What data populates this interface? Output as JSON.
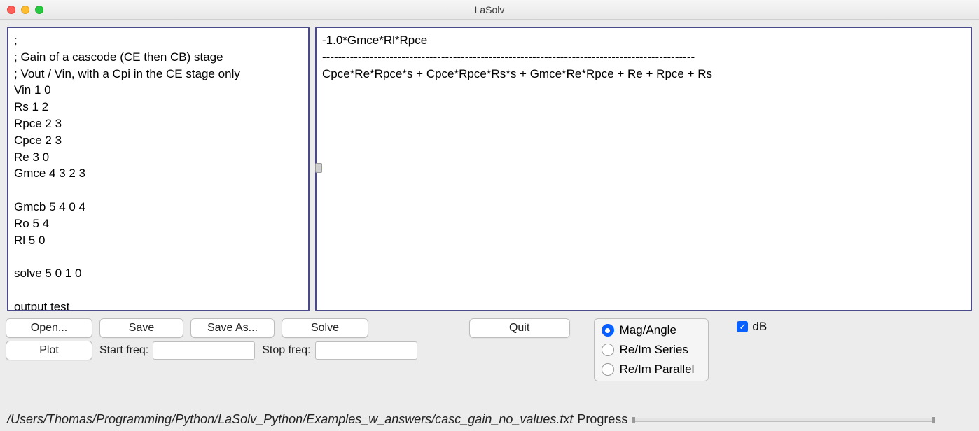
{
  "window": {
    "title": "LaSolv"
  },
  "editor": {
    "input_text": ";\n; Gain of a cascode (CE then CB) stage\n; Vout / Vin, with a Cpi in the CE stage only\nVin 1 0\nRs 1 2\nRpce 2 3\nCpce 2 3\nRe 3 0\nGmce 4 3 2 3\n\nGmcb 5 4 0 4\nRo 5 4\nRl 5 0\n\nsolve 5 0 1 0\n\noutput test",
    "output_text": "-1.0*Gmce*Rl*Rpce\n----------------------------------------------------------------------------------------------\nCpce*Re*Rpce*s + Cpce*Rpce*Rs*s + Gmce*Re*Rpce + Re + Rpce + Rs"
  },
  "buttons": {
    "open": "Open...",
    "save": "Save",
    "save_as": "Save As...",
    "solve": "Solve",
    "quit": "Quit",
    "plot": "Plot"
  },
  "freq": {
    "start_label": "Start freq:",
    "start_value": "",
    "stop_label": "Stop freq:",
    "stop_value": ""
  },
  "radios": {
    "mag_angle": "Mag/Angle",
    "reim_series": "Re/Im Series",
    "reim_parallel": "Re/Im Parallel",
    "selected": "mag_angle"
  },
  "checkbox": {
    "db_label": "dB",
    "db_checked": true
  },
  "status": {
    "path": "/Users/Thomas/Programming/Python/LaSolv_Python/Examples_w_answers/casc_gain_no_values.txt",
    "progress_label": "Progress"
  }
}
